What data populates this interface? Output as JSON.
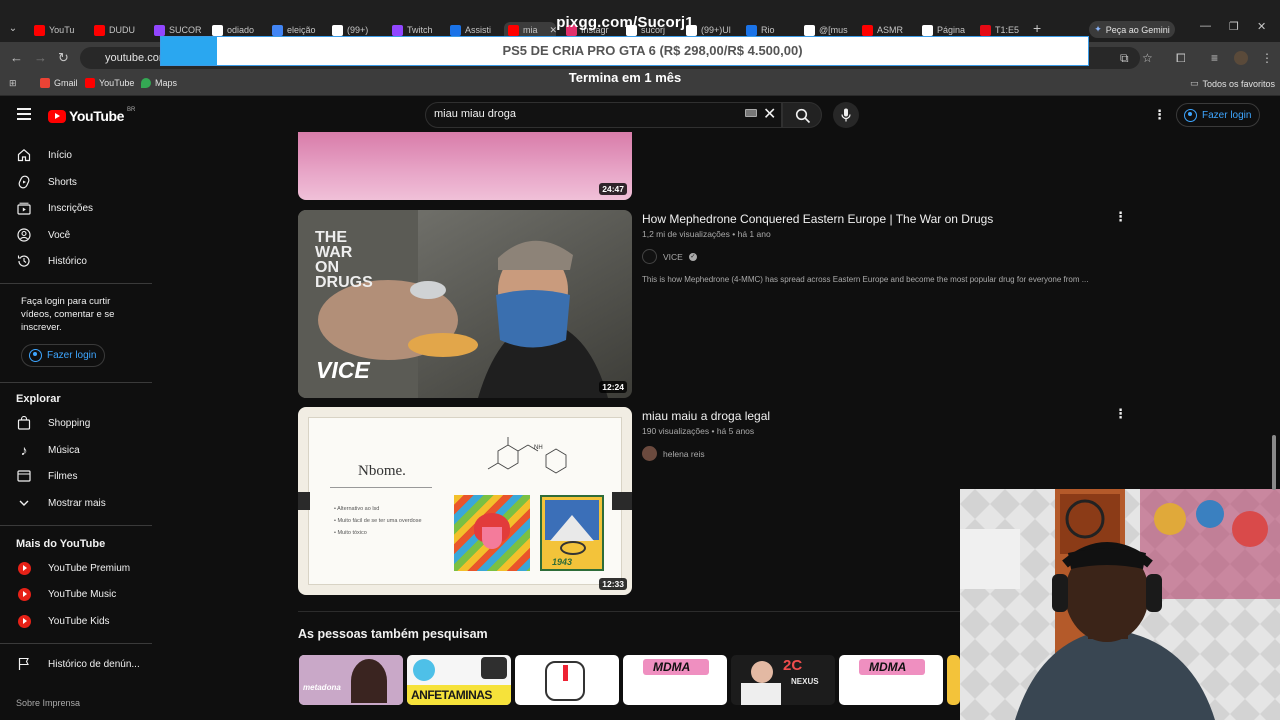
{
  "stream": {
    "title": "pixgg.com/Sucorj1",
    "promo_text": "PS5 DE CRIA PRO GTA 6 (R$ 298,00/R$ 4.500,00)",
    "ends_in": "Termina em 1 mês"
  },
  "browser": {
    "tabs": [
      {
        "label": "YouTu",
        "color": "#ff0000"
      },
      {
        "label": "DUDU",
        "color": "#ff0000"
      },
      {
        "label": "SUCOR",
        "color": "#9146ff"
      },
      {
        "label": "odiado",
        "color": "#ffffff"
      },
      {
        "label": "eleição",
        "color": "#4285f4"
      },
      {
        "label": "(99+)",
        "color": "#ffffff"
      },
      {
        "label": "Twitch",
        "color": "#9146ff"
      },
      {
        "label": "Assisti",
        "color": "#1a73e8"
      },
      {
        "label": "mia",
        "color": "#ff0000"
      },
      {
        "label": "Instagr",
        "color": "#e1306c"
      },
      {
        "label": "sucorj",
        "color": "#ffffff"
      },
      {
        "label": "(99+)Ul",
        "color": "#ffffff"
      },
      {
        "label": "Rio",
        "color": "#1a73e8"
      },
      {
        "label": "@[mus",
        "color": "#ffffff"
      },
      {
        "label": "ASMR",
        "color": "#ff0000"
      },
      {
        "label": "Página",
        "color": "#ffffff"
      },
      {
        "label": "T1:E5",
        "color": "#e50914"
      }
    ],
    "gemini_button": "Peça ao Gemini",
    "url": "youtube.com",
    "bookmarks": {
      "gmail": "Gmail",
      "youtube": "YouTube",
      "maps": "Maps",
      "all": "Todos os favoritos"
    }
  },
  "header": {
    "logo": "YouTube",
    "country": "BR",
    "search_value": "miau miau droga",
    "login": "Fazer login"
  },
  "sidebar": {
    "items": [
      {
        "label": "Início",
        "icon": "home-icon"
      },
      {
        "label": "Shorts",
        "icon": "shorts-icon"
      },
      {
        "label": "Inscrições",
        "icon": "subscriptions-icon"
      },
      {
        "label": "Você",
        "icon": "you-icon"
      },
      {
        "label": "Histórico",
        "icon": "history-icon"
      }
    ],
    "login_text": "Faça login para curtir vídeos, comentar e se inscrever.",
    "login_button": "Fazer login",
    "explore_heading": "Explorar",
    "explore": [
      "Shopping",
      "Música",
      "Filmes",
      "Mostrar mais"
    ],
    "more_heading": "Mais do YouTube",
    "more": [
      "YouTube Premium",
      "YouTube Music",
      "YouTube Kids"
    ],
    "report_history": "Histórico de denún...",
    "footer": "Sobre  Imprensa"
  },
  "results": [
    {
      "duration": "24:47"
    },
    {
      "title": "How Mephedrone Conquered Eastern Europe | The War on Drugs",
      "views": "1,2 mi de visualizações",
      "age": "há 1 ano",
      "channel": "VICE",
      "description": "This is how Mephedrone (4-MMC) has spread across Eastern Europe and become the most popular drug for everyone from ...",
      "duration": "12:24",
      "thumb_text": "THE WAR ON DRUGS",
      "thumb_logo": "VICE"
    },
    {
      "title": "miau maiu a droga legal",
      "views": "190 visualizações",
      "age": "há 5 anos",
      "channel": "helena reis",
      "duration": "12:33",
      "slide_title": "Nbome.",
      "slide_bullets": [
        "Alternativo ao lsd",
        "Muito fácil de se ter uma overdose",
        "Muito tóxico"
      ],
      "poster_year": "1943"
    }
  ],
  "related": {
    "heading": "As pessoas também pesquisam",
    "cards": [
      {
        "label": "metadona",
        "bg": "#c9a8c8"
      },
      {
        "label": "ANFETAMINAS",
        "bg": "#f6f6f6"
      },
      {
        "label": "",
        "bg": "#ffffff"
      },
      {
        "label": "MDMA",
        "bg": "#ffffff"
      },
      {
        "label": "NEXUS",
        "bg": "#1c1c1c"
      },
      {
        "label": "MDMA",
        "bg": "#ffffff"
      }
    ]
  }
}
